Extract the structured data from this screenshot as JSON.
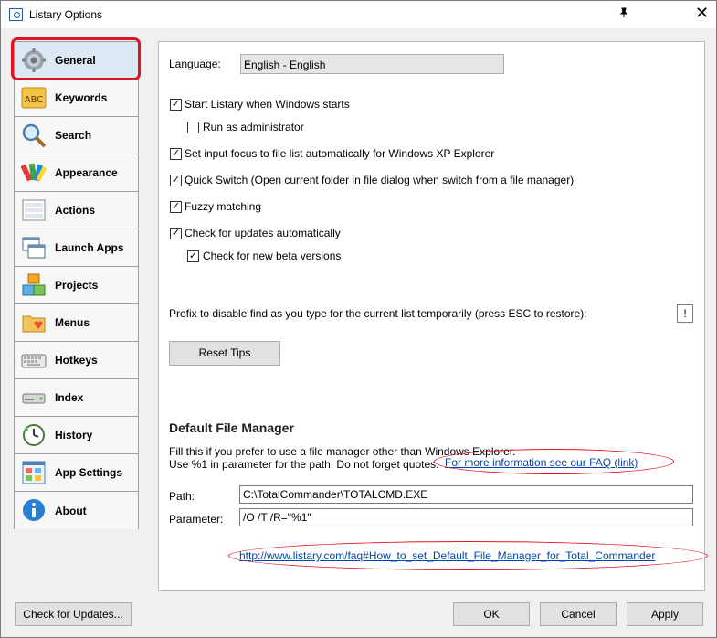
{
  "window": {
    "title": "Listary Options",
    "pin_glyph": "★",
    "close_glyph": "✕"
  },
  "nav": {
    "items": [
      {
        "label": "General",
        "icon": "gear-icon"
      },
      {
        "label": "Keywords",
        "icon": "abc-icon"
      },
      {
        "label": "Search",
        "icon": "magnifier-icon"
      },
      {
        "label": "Appearance",
        "icon": "palette-icon"
      },
      {
        "label": "Actions",
        "icon": "menu-list-icon"
      },
      {
        "label": "Launch Apps",
        "icon": "windows-icon"
      },
      {
        "label": "Projects",
        "icon": "boxes-icon"
      },
      {
        "label": "Menus",
        "icon": "folder-heart-icon"
      },
      {
        "label": "Hotkeys",
        "icon": "keyboard-icon"
      },
      {
        "label": "Index",
        "icon": "drive-icon"
      },
      {
        "label": "History",
        "icon": "clock-icon"
      },
      {
        "label": "App Settings",
        "icon": "app-grid-icon"
      },
      {
        "label": "About",
        "icon": "info-icon"
      }
    ]
  },
  "general": {
    "language_label": "Language:",
    "language_value": "English - English",
    "checkboxes": {
      "start_with_windows": {
        "label": "Start Listary when Windows starts",
        "checked": "✓"
      },
      "run_as_admin": {
        "label": "Run as administrator",
        "checked": ""
      },
      "input_focus": {
        "label": "Set input focus to file list automatically for Windows XP Explorer",
        "checked": "✓"
      },
      "quick_switch": {
        "label": "Quick Switch (Open current folder in file dialog when switch from a file manager)",
        "checked": "✓"
      },
      "fuzzy": {
        "label": "Fuzzy matching",
        "checked": "✓"
      },
      "updates": {
        "label": "Check for updates automatically",
        "checked": "✓"
      },
      "beta": {
        "label": "Check for new beta versions",
        "checked": "✓"
      }
    },
    "prefix_label": "Prefix to disable find as you type for the current list temporarily (press ESC to restore):",
    "prefix_value": "!",
    "reset_tips": "Reset Tips"
  },
  "file_manager": {
    "title": "Default File Manager",
    "desc1": "Fill this if you prefer to use a file manager other than Windows Explorer.",
    "desc2": "Use %1 in parameter for the path. Do not forget quotes.",
    "faq_text": "For more information see our FAQ (link)",
    "path_label": "Path:",
    "path_value": "C:\\TotalCommander\\TOTALCMD.EXE",
    "param_label": "Parameter:",
    "param_value": "/O /T /R=\"%1\"",
    "url": "http://www.listary.com/faq#How_to_set_Default_File_Manager_for_Total_Commander"
  },
  "footer": {
    "check_updates": "Check for Updates...",
    "ok": "OK",
    "cancel": "Cancel",
    "apply": "Apply"
  },
  "colors": {
    "annotation": "#e0141e",
    "link": "#0645ad",
    "selected_nav": "#dde8f5"
  }
}
